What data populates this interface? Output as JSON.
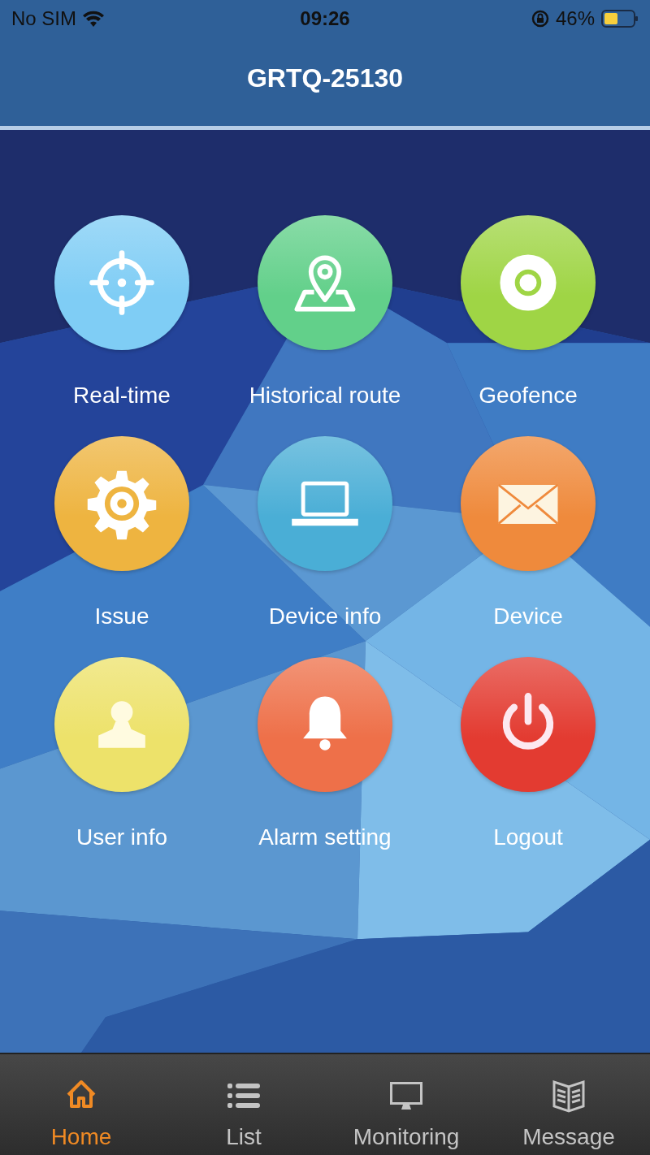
{
  "status_bar": {
    "carrier": "No SIM",
    "time": "09:26",
    "battery": "46%"
  },
  "header": {
    "title": "GRTQ-25130"
  },
  "tiles": [
    {
      "kind": "crosshair",
      "label": "Real-time",
      "color": "#7fcdf5"
    },
    {
      "kind": "pin",
      "label": "Historical route",
      "color": "#62d08a"
    },
    {
      "kind": "target",
      "label": "Geofence",
      "color": "#9fd545"
    },
    {
      "kind": "gear",
      "label": "Issue",
      "color": "#eeb440"
    },
    {
      "kind": "laptop",
      "label": "Device info",
      "color": "#4aaed6"
    },
    {
      "kind": "envelope",
      "label": "Device",
      "color": "#ef8a3c"
    },
    {
      "kind": "person",
      "label": "User info",
      "color": "#ede26a"
    },
    {
      "kind": "bell",
      "label": "Alarm setting",
      "color": "#ee7049"
    },
    {
      "kind": "power",
      "label": "Logout",
      "color": "#e33b31"
    }
  ],
  "tabs": [
    {
      "kind": "home",
      "label": "Home",
      "selected": true
    },
    {
      "kind": "list",
      "label": "List",
      "selected": false
    },
    {
      "kind": "monitor",
      "label": "Monitoring",
      "selected": false
    },
    {
      "kind": "book",
      "label": "Message",
      "selected": false
    }
  ]
}
